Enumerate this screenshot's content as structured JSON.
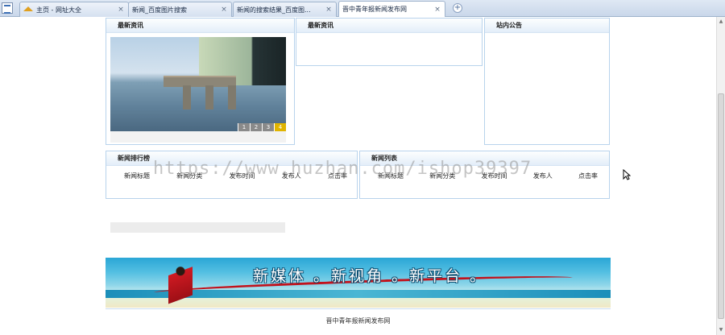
{
  "browser": {
    "tabs": [
      {
        "label": "主页 - 网址大全",
        "icon": "home-icon"
      },
      {
        "label": "新闻_百度图片搜索",
        "icon": "page-icon"
      },
      {
        "label": "新闻的搜索结果_百度图...",
        "icon": "page-icon"
      },
      {
        "label": "晋中青年报新闻发布网",
        "icon": "page-icon",
        "active": true
      }
    ],
    "close_glyph": "×",
    "new_tab_glyph": "+"
  },
  "sections": {
    "latest_news_1": {
      "title": "最新资讯"
    },
    "latest_news_2": {
      "title": "最新资讯"
    },
    "announcements": {
      "title": "站内公告"
    },
    "news_ranking": {
      "title": "新闻排行榜",
      "columns": [
        "新闻标题",
        "新闻分类",
        "发布时间",
        "发布人",
        "点击率"
      ]
    },
    "news_list": {
      "title": "新闻列表",
      "columns": [
        "新闻标题",
        "新闻分类",
        "发布时间",
        "发布人",
        "点击率"
      ]
    }
  },
  "slideshow": {
    "pages": [
      "1",
      "2",
      "3",
      "4"
    ],
    "active_page": "4"
  },
  "banner": {
    "slogan": "新媒体 。新视角 。新平台 。"
  },
  "footer": {
    "text": "晋中青年报新闻发布网"
  },
  "watermark": {
    "text": "https://www.huzhan.com/ishop39397"
  },
  "colors": {
    "box_border": "#b8d3ec",
    "active_page": "#e0b400",
    "ribbon": "#c2121c"
  }
}
